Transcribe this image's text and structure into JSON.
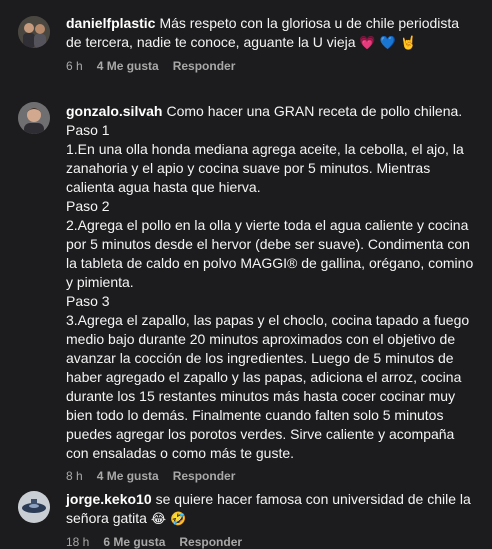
{
  "comments": [
    {
      "username": "danielfplastic",
      "text": "Más respeto con la gloriosa u de chile periodista de tercera, nadie te conoce, aguante la U vieja",
      "emojis": "💗 💙 🤘",
      "time": "6 h",
      "likes": "4 Me gusta",
      "reply": "Responder"
    },
    {
      "username": "gonzalo.silvah",
      "text": "Como hacer una GRAN receta de pollo chilena.\nPaso 1\n1.En una olla honda mediana agrega aceite, la cebolla, el ajo, la zanahoria y el apio y cocina suave por 5 minutos. Mientras calienta agua hasta que hierva.\nPaso 2\n2.Agrega el pollo en la olla y vierte toda el agua caliente y cocina por 5 minutos desde el hervor (debe ser suave). Condimenta con la tableta de caldo en polvo MAGGI® de gallina, orégano, comino y pimienta.\nPaso 3\n3.Agrega el zapallo, las papas y el choclo, cocina tapado a fuego medio bajo durante 20 minutos aproximados con el objetivo de avanzar la cocción de los ingredientes. Luego de 5 minutos de haber agregado el zapallo y las papas, adiciona el arroz, cocina durante los 15 restantes minutos más hasta cocer cocinar muy bien todo lo demás. Finalmente cuando falten solo 5 minutos puedes agregar los porotos verdes. Sirve caliente y acompaña con ensaladas o como más te guste.",
      "emojis": "",
      "time": "8 h",
      "likes": "4 Me gusta",
      "reply": "Responder"
    },
    {
      "username": "jorge.keko10",
      "text": "se quiere hacer famosa con universidad de chile la señora gatita",
      "emojis": "😂 🤣",
      "time": "18 h",
      "likes": "6 Me gusta",
      "reply": "Responder"
    }
  ],
  "colors": {
    "background": "#1c1c1e",
    "text": "#f5f5f5",
    "meta": "#a8a8a8"
  }
}
